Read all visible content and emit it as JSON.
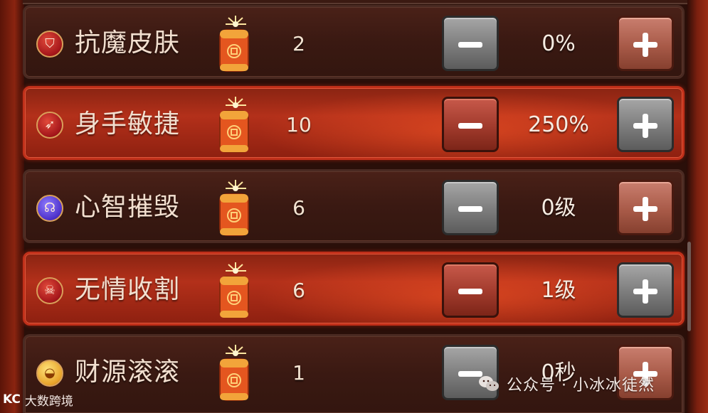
{
  "skills": [
    {
      "name": "抗魔皮肤",
      "count": "2",
      "value": "0%",
      "icon": "shield-icon",
      "icon_glyph": "⛉",
      "active": false
    },
    {
      "name": "身手敏捷",
      "count": "10",
      "value": "250%",
      "icon": "boot-icon",
      "icon_glyph": "➶",
      "active": true
    },
    {
      "name": "心智摧毁",
      "count": "6",
      "value": "0级",
      "icon": "mind-icon",
      "icon_glyph": "☊",
      "active": false
    },
    {
      "name": "无情收割",
      "count": "6",
      "value": "1级",
      "icon": "scythe-icon",
      "icon_glyph": "☠",
      "active": true
    },
    {
      "name": "财源滚滚",
      "count": "1",
      "value": "0秒",
      "icon": "gold-ingot-icon",
      "icon_glyph": "◒",
      "active": false
    }
  ],
  "cost_icon": "firecracker-icon",
  "colors": {
    "row_bg": "#3a1912",
    "row_active": "#b3301a",
    "text": "#f2dfcf",
    "btn_gray": "#7c7c7c",
    "btn_red": "#a85a48"
  },
  "watermark": {
    "left_logo": "KC",
    "left_text": "大数跨境",
    "right_text": "公众号 · 小冰冰徒然"
  }
}
